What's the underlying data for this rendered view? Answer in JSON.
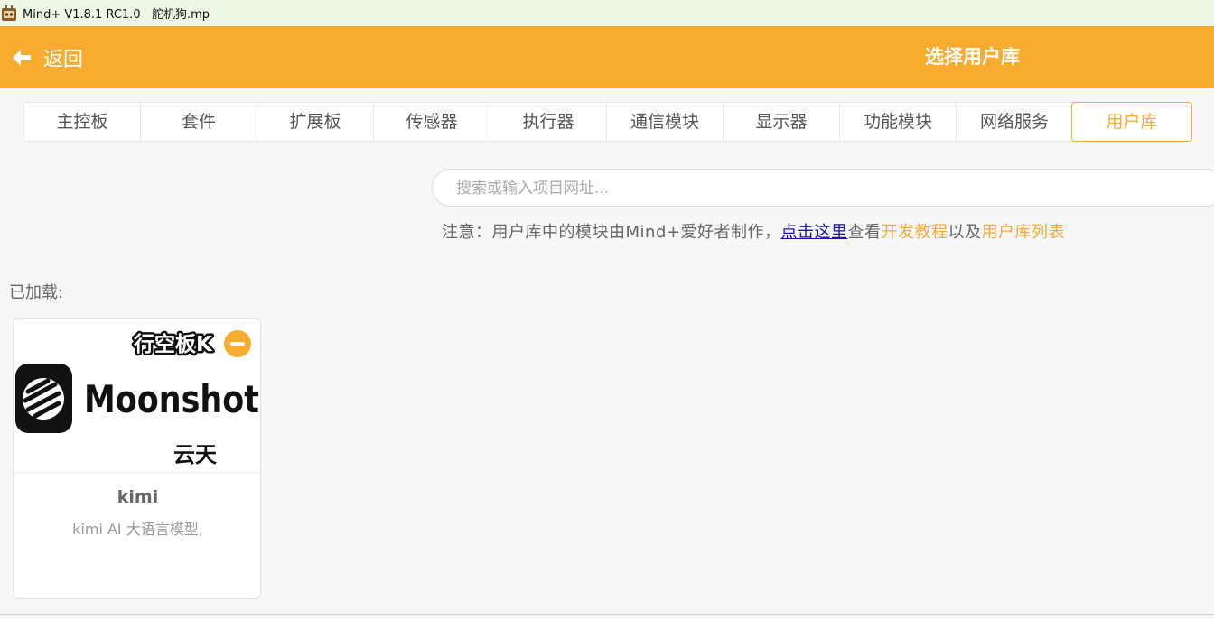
{
  "window": {
    "title": "Mind+ V1.8.1 RC1.0   舵机狗.mp",
    "icon": "mindplus-app-icon"
  },
  "header": {
    "back_label": "返回",
    "title": "选择用户库",
    "accent_color": "#f8ac2f"
  },
  "tabs": [
    {
      "label": "主控板",
      "active": false
    },
    {
      "label": "套件",
      "active": false
    },
    {
      "label": "扩展板",
      "active": false
    },
    {
      "label": "传感器",
      "active": false
    },
    {
      "label": "执行器",
      "active": false
    },
    {
      "label": "通信模块",
      "active": false
    },
    {
      "label": "显示器",
      "active": false
    },
    {
      "label": "功能模块",
      "active": false
    },
    {
      "label": "网络服务",
      "active": false
    },
    {
      "label": "用户库",
      "active": true
    }
  ],
  "search": {
    "placeholder": "搜索或输入项目网址...",
    "value": ""
  },
  "notice": {
    "prefix": "注意：用户库中的模块由Mind+爱好者制作，",
    "link_here": "点击这里",
    "mid": "查看",
    "link_tutorial": "开发教程",
    "mid2": "以及",
    "link_list": "用户库列表"
  },
  "loaded": {
    "label": "已加载:",
    "items": [
      {
        "image_top_text": "行空板K",
        "image_brand": "Moonshot",
        "image_bottom_text": "云天",
        "title": "kimi",
        "description": "kimi AI 大语言模型,"
      }
    ]
  }
}
